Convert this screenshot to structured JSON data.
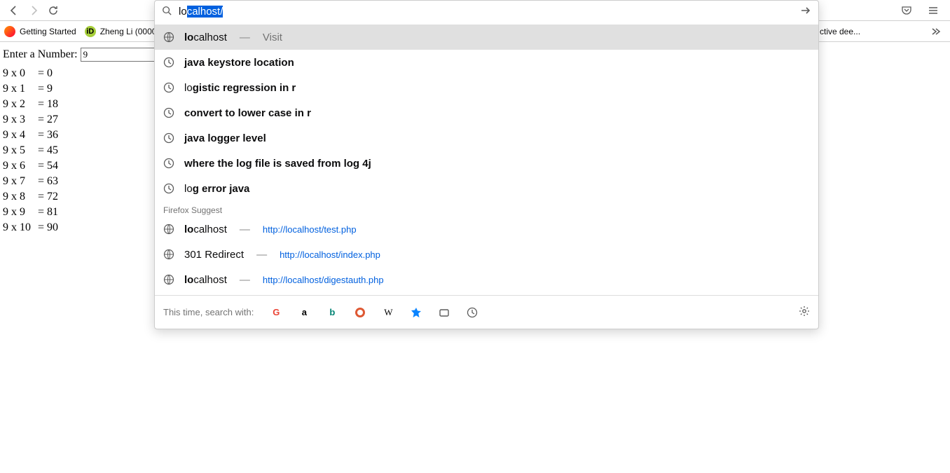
{
  "urlbar": {
    "typed": "lo",
    "autocomplete": "calhost/"
  },
  "suggestions_top": {
    "title_strong": "lo",
    "title_rest": "calhost",
    "sep": "—",
    "visit": "Visit"
  },
  "history": [
    {
      "pre": "",
      "strong1": "java keystore lo",
      "mid": "",
      "strong2": "cation",
      "post": ""
    },
    {
      "pre": "lo",
      "strong1": "gistic regression in r",
      "mid": "",
      "strong2": "",
      "post": ""
    },
    {
      "pre": "",
      "strong1": "convert to lo",
      "mid": "",
      "strong2": "wer case in r",
      "post": ""
    },
    {
      "pre": "",
      "strong1": "java lo",
      "mid": "",
      "strong2": "gger level",
      "post": ""
    },
    {
      "pre": "",
      "strong1": "where the lo",
      "mid": "",
      "strong2": "g file is saved from lo",
      "post": "",
      "strong3": "g 4j"
    },
    {
      "pre": "lo",
      "strong1": "g error java",
      "mid": "",
      "strong2": "",
      "post": ""
    }
  ],
  "suggest_header": "Firefox Suggest",
  "suggest_items": [
    {
      "title_strong": "lo",
      "title_rest": "calhost",
      "sep": "—",
      "url": "http://localhost/test.php"
    },
    {
      "title_strong": "",
      "title_rest": "301 Redirect",
      "sep": "—",
      "url": "http://localhost/index.php"
    },
    {
      "title_strong": "lo",
      "title_rest": "calhost",
      "sep": "—",
      "url": "http://localhost/digestauth.php"
    }
  ],
  "search_strip_label": "This time, search with:",
  "bookmarks": {
    "b1": "Getting Started",
    "b2": "Zheng Li (0000-",
    "right_truncated": "ctive dee..."
  },
  "page": {
    "label": "Enter a Number:",
    "value": "9",
    "rows": [
      {
        "lhs": "9 x 0",
        "rhs": "= 0"
      },
      {
        "lhs": "9 x 1",
        "rhs": "= 9"
      },
      {
        "lhs": "9 x 2",
        "rhs": "= 18"
      },
      {
        "lhs": "9 x 3",
        "rhs": "= 27"
      },
      {
        "lhs": "9 x 4",
        "rhs": "= 36"
      },
      {
        "lhs": "9 x 5",
        "rhs": "= 45"
      },
      {
        "lhs": "9 x 6",
        "rhs": "= 54"
      },
      {
        "lhs": "9 x 7",
        "rhs": "= 63"
      },
      {
        "lhs": "9 x 8",
        "rhs": "= 72"
      },
      {
        "lhs": "9 x 9",
        "rhs": "= 81"
      },
      {
        "lhs": "9 x 10",
        "rhs": "= 90"
      }
    ]
  },
  "engines": [
    "google",
    "amazon",
    "bing",
    "duckduckgo",
    "wikipedia",
    "bookmarks",
    "tabs",
    "history"
  ]
}
